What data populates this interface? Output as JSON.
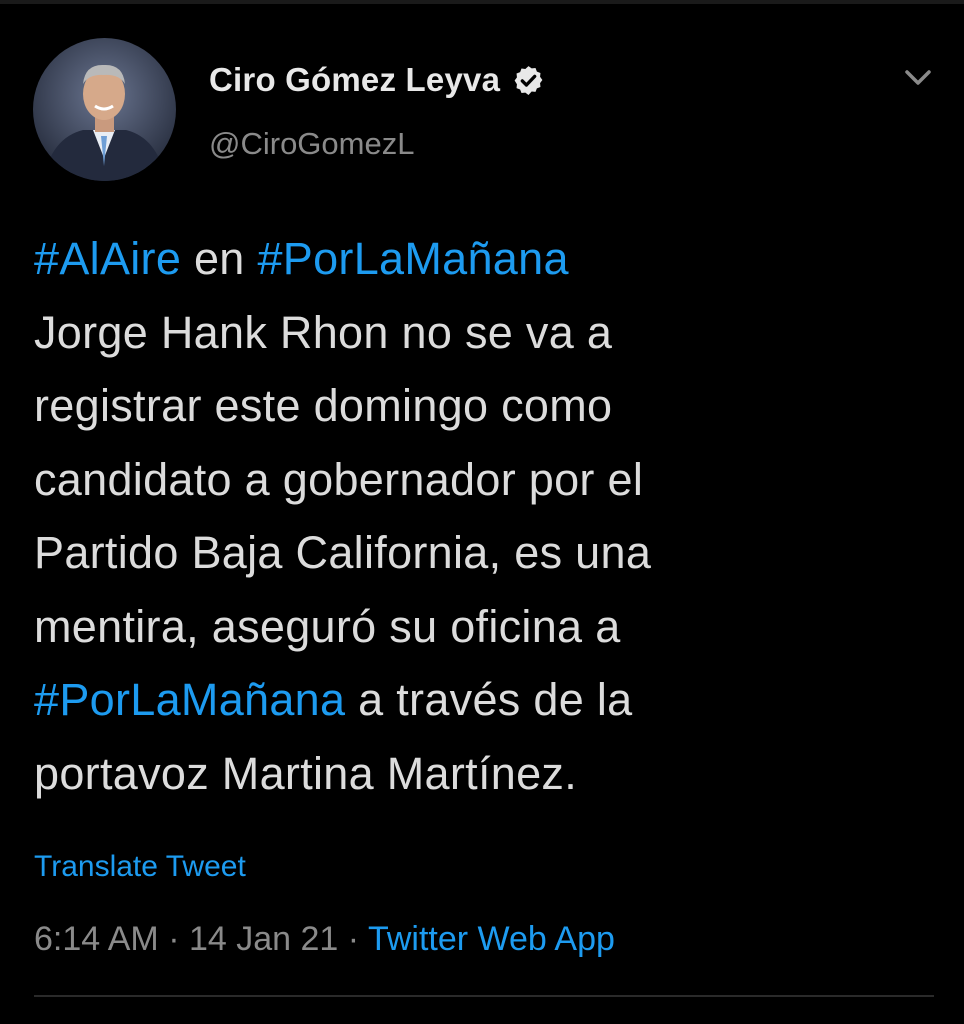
{
  "author": {
    "display_name": "Ciro Gómez Leyva",
    "handle": "@CiroGomezL",
    "verified_icon": "verified-badge-icon"
  },
  "tweet": {
    "lines": [
      [
        {
          "text": "#AlAire",
          "hashtag": true
        },
        {
          "text": " en ",
          "hashtag": false
        },
        {
          "text": "#PorLaMañana",
          "hashtag": true
        }
      ],
      [
        {
          "text": "Jorge Hank Rhon no se va a",
          "hashtag": false
        }
      ],
      [
        {
          "text": "registrar este domingo como",
          "hashtag": false
        }
      ],
      [
        {
          "text": "candidato a gobernador por el",
          "hashtag": false
        }
      ],
      [
        {
          "text": "Partido Baja California, es una",
          "hashtag": false
        }
      ],
      [
        {
          "text": "mentira, aseguró su oficina a",
          "hashtag": false
        }
      ],
      [
        {
          "text": "#PorLaMañana",
          "hashtag": true
        },
        {
          "text": " a través de la",
          "hashtag": false
        }
      ],
      [
        {
          "text": "portavoz Martina Martínez.",
          "hashtag": false
        }
      ]
    ],
    "translate_label": "Translate Tweet",
    "time": "6:14 AM",
    "separator": "·",
    "date": "14 Jan 21",
    "source": "Twitter Web App"
  },
  "icons": {
    "menu": "chevron-down-icon",
    "avatar": "avatar-photo"
  },
  "colors": {
    "background": "#000000",
    "accent": "#1d9bf0",
    "text_primary": "#dcdcdc",
    "text_secondary": "#8a8a8a"
  }
}
